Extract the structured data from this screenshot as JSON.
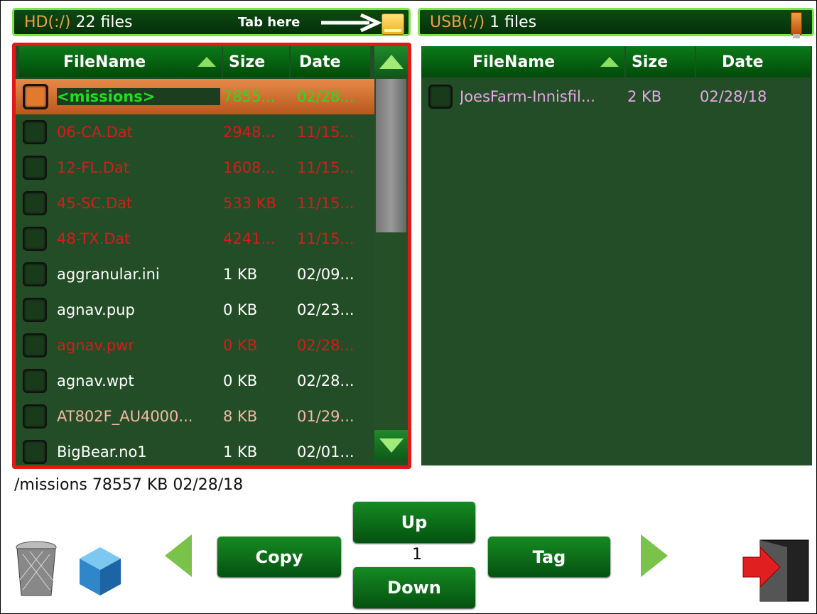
{
  "hd_panel": {
    "device_label": "HD(:/)",
    "file_count": "22 files",
    "tab_hint": "Tab here",
    "columns": {
      "name": "FileName",
      "size": "Size",
      "date": "Date"
    },
    "rows": [
      {
        "name": "<missions>",
        "size": "7855...",
        "date": "02/28...",
        "color": "#20e020",
        "selected": true
      },
      {
        "name": "06-CA.Dat",
        "size": "2948...",
        "date": "11/15...",
        "color": "#d41c1c"
      },
      {
        "name": "12-FL.Dat",
        "size": "1608...",
        "date": "11/15...",
        "color": "#d41c1c"
      },
      {
        "name": "45-SC.Dat",
        "size": "533 KB",
        "date": "11/15...",
        "color": "#d41c1c"
      },
      {
        "name": "48-TX.Dat",
        "size": "4241...",
        "date": "11/15...",
        "color": "#d41c1c"
      },
      {
        "name": "aggranular.ini",
        "size": "1 KB",
        "date": "02/09...",
        "color": "#ffffff"
      },
      {
        "name": "agnav.pup",
        "size": "0 KB",
        "date": "02/23...",
        "color": "#ffffff"
      },
      {
        "name": "agnav.pwr",
        "size": "0 KB",
        "date": "02/28...",
        "color": "#d41c1c"
      },
      {
        "name": "agnav.wpt",
        "size": "0 KB",
        "date": "02/28...",
        "color": "#ffffff"
      },
      {
        "name": "AT802F_AU4000...",
        "size": "8 KB",
        "date": "01/29...",
        "color": "#f4b8a8"
      },
      {
        "name": "BigBear.no1",
        "size": "1 KB",
        "date": "02/01...",
        "color": "#ffffff"
      }
    ]
  },
  "usb_panel": {
    "device_label": "USB(:/)",
    "file_count": "1 files",
    "columns": {
      "name": "FileName",
      "size": "Size",
      "date": "Date"
    },
    "rows": [
      {
        "name": "JoesFarm-Innisfil...",
        "size": "2 KB",
        "date": "02/28/18",
        "color": "#e8a8e8"
      }
    ]
  },
  "status": {
    "text": "/missions  78557 KB  02/28/18"
  },
  "controls": {
    "up": "Up",
    "down": "Down",
    "copy": "Copy",
    "tag": "Tag",
    "counter": "1"
  },
  "icons": [
    "drive-icon",
    "usb-icon",
    "trash-icon",
    "cube-icon",
    "exit-icon",
    "arrow-left-icon",
    "arrow-right-icon"
  ]
}
